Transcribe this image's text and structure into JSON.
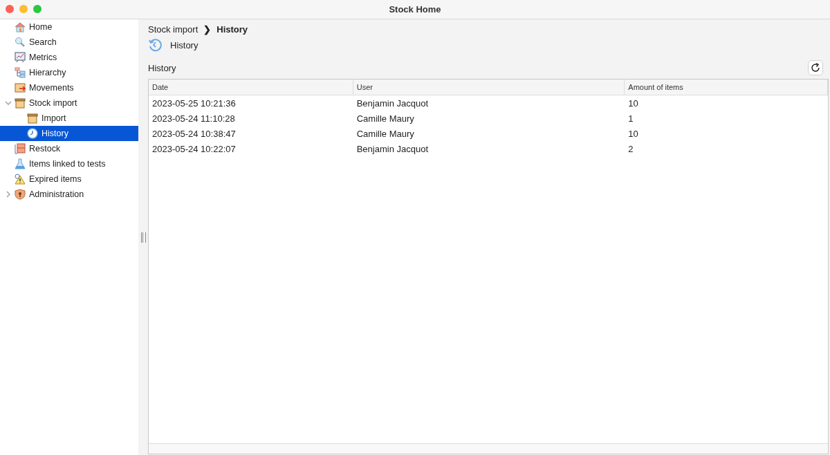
{
  "window": {
    "title": "Stock Home"
  },
  "sidebar": {
    "items": [
      {
        "label": "Home",
        "selected": false
      },
      {
        "label": "Search",
        "selected": false
      },
      {
        "label": "Metrics",
        "selected": false
      },
      {
        "label": "Hierarchy",
        "selected": false
      },
      {
        "label": "Movements",
        "selected": false
      },
      {
        "label": "Stock import",
        "selected": false,
        "expanded": true,
        "children": [
          {
            "label": "Import",
            "selected": false
          },
          {
            "label": "History",
            "selected": true
          }
        ]
      },
      {
        "label": "Restock",
        "selected": false
      },
      {
        "label": "Items linked to tests",
        "selected": false
      },
      {
        "label": "Expired items",
        "selected": false
      },
      {
        "label": "Administration",
        "selected": false,
        "expanded": false
      }
    ]
  },
  "breadcrumb": {
    "parent": "Stock import",
    "separator": "❯",
    "current": "History"
  },
  "page_heading": "History",
  "section_title": "History",
  "table": {
    "columns": [
      "Date",
      "User",
      "Amount of items"
    ],
    "rows": [
      [
        "2023-05-25 10:21:36",
        "Benjamin Jacquot",
        "10"
      ],
      [
        "2023-05-24 11:10:28",
        "Camille Maury",
        "1"
      ],
      [
        "2023-05-24 10:38:47",
        "Camille Maury",
        "10"
      ],
      [
        "2023-05-24 10:22:07",
        "Benjamin Jacquot",
        "2"
      ]
    ]
  }
}
